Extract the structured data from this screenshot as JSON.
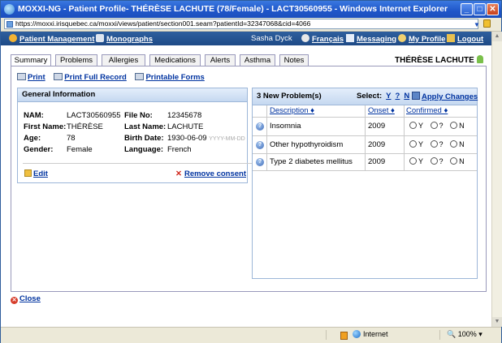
{
  "window": {
    "title": "MOXXI-NG - Patient Profile- THÉRÈSE LACHUTE (78/Female) - LACT30560955 - Windows Internet Explorer",
    "url": "https://moxxi.irisquebec.ca/moxxi/views/patient/section001.seam?patientId=32347068&cid=4066",
    "minimize": "_",
    "maximize": "□",
    "close": "✕"
  },
  "menu": {
    "patient_management": "Patient Management",
    "monographs": "Monographs",
    "user": "Sasha Dyck",
    "francais": "Français",
    "messaging": "Messaging",
    "my_profile": "My Profile",
    "logout": "Logout"
  },
  "tabs": [
    "Summary",
    "Problems",
    "Allergies",
    "Medications",
    "Alerts",
    "Asthma",
    "Notes"
  ],
  "active_tab": "Summary",
  "patient_name": "THÉRÈSE LACHUTE",
  "actions": {
    "print": "Print",
    "print_full": "Print Full Record",
    "printable_forms": "Printable Forms"
  },
  "general": {
    "header": "General Information",
    "nam_label": "NAM:",
    "nam": "LACT30560955",
    "file_label": "File No:",
    "file": "12345678",
    "first_label": "First Name:",
    "first": "THÉRÈSE",
    "last_label": "Last Name:",
    "last": "LACHUTE",
    "age_label": "Age:",
    "age": "78",
    "birth_label": "Birth Date:",
    "birth": "1930-06-09",
    "birth_hint": "YYYY-MM-DD",
    "gender_label": "Gender:",
    "gender": "Female",
    "language_label": "Language:",
    "language": "French",
    "edit": "Edit",
    "remove_consent": "Remove consent"
  },
  "problems": {
    "header": "3 New Problem(s)",
    "select_label": "Select:",
    "select_y": "Y",
    "select_q": "?",
    "select_n": "N",
    "apply": "Apply Changes",
    "col_description": "Description ♦",
    "col_onset": "Onset ♦",
    "col_confirmed": "Confirmed ♦",
    "rows": [
      {
        "description": "Insomnia",
        "onset": "2009"
      },
      {
        "description": "Other hypothyroidism",
        "onset": "2009"
      },
      {
        "description": "Type 2 diabetes mellitus",
        "onset": "2009"
      }
    ],
    "radio_y": "Y",
    "radio_q": "?",
    "radio_n": "N"
  },
  "close": "Close",
  "status": {
    "zone": "Internet",
    "zoom": "100%"
  }
}
